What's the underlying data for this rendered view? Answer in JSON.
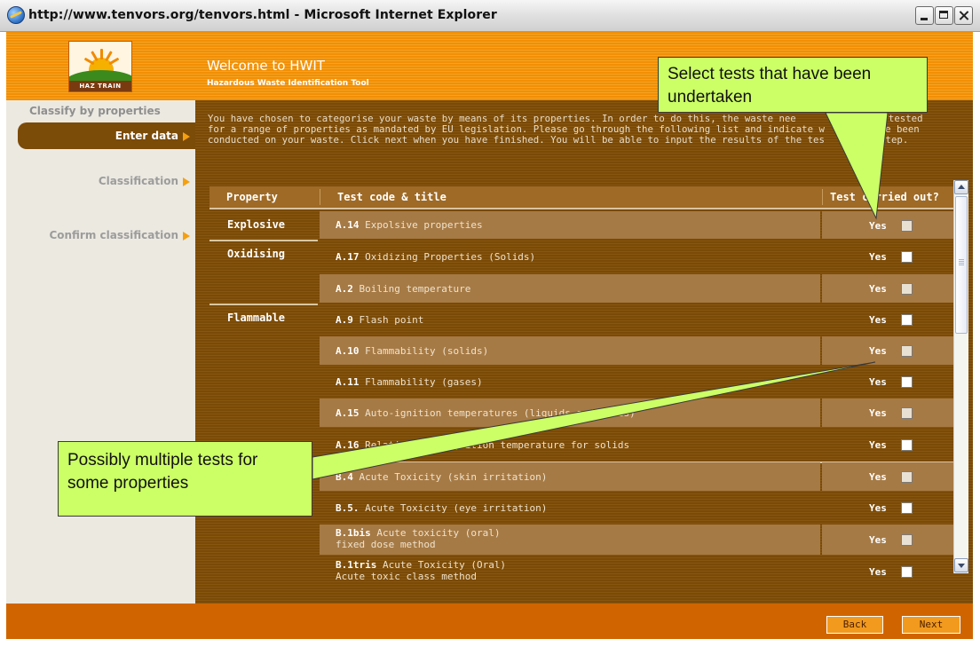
{
  "window": {
    "title": "http://www.tenvors.org/tenvors.html - Microsoft Internet Explorer"
  },
  "header": {
    "logo_text": "HAZ TRAIN",
    "title": "Welcome to HWIT",
    "subtitle": "Hazardous Waste Identification Tool"
  },
  "sidebar": {
    "category": "Classify by properties",
    "items": [
      {
        "label": "Enter data",
        "active": true
      },
      {
        "label": "Classification",
        "active": false
      },
      {
        "label": "Confirm classification",
        "active": false
      }
    ]
  },
  "intro": {
    "text_visible": "You have chosen to categorise your waste by means of its properties. In order to do this, the waste nee",
    "text_mid": "been tested",
    "line2_a": "for a range of properties as mandated by EU legislation. Please go through the following list and indicate w",
    "line2_b": "s have been",
    "line3_a": "conducted on your waste. Click next when you have finished. You will be able to input the results of the tes",
    "line3_b": "next step."
  },
  "table": {
    "headers": {
      "property": "Property",
      "test": "Test code & title",
      "carried_out": "Test carried out?"
    },
    "yes_label": "Yes",
    "rows": [
      {
        "property": "Explosive",
        "code": "A.14",
        "title": "Expolsive properties",
        "line2": "",
        "shade": "light"
      },
      {
        "property": "Oxidising",
        "code": "A.17",
        "title": "Oxidizing Properties (Solids)",
        "line2": "",
        "shade": "dark"
      },
      {
        "property": "",
        "code": "A.2",
        "title": "Boiling temperature",
        "line2": "",
        "shade": "light"
      },
      {
        "property": "Flammable",
        "code": "A.9",
        "title": "Flash point",
        "line2": "",
        "shade": "dark"
      },
      {
        "property": "",
        "code": "A.10",
        "title": "Flammability (solids)",
        "line2": "",
        "shade": "light"
      },
      {
        "property": "",
        "code": "A.11",
        "title": "Flammability (gases)",
        "line2": "",
        "shade": "dark"
      },
      {
        "property": "",
        "code": "A.15",
        "title": "Auto-ignition temperatures (liquids and gases)",
        "line2": "",
        "shade": "light"
      },
      {
        "property": "",
        "code": "A.16",
        "title": "Relative self-ignition temperature for solids",
        "line2": "",
        "shade": "dark"
      },
      {
        "property": "",
        "code": "B.4",
        "title": "Acute Toxicity (skin irritation)",
        "line2": "",
        "shade": "light"
      },
      {
        "property": "",
        "code": "B.5.",
        "title": "Acute Toxicity (eye irritation)",
        "line2": "",
        "shade": "dark"
      },
      {
        "property": "",
        "code": "B.1bis",
        "title": "Acute toxicity (oral)",
        "line2": "fixed dose method",
        "shade": "light"
      },
      {
        "property": "",
        "code": "B.1tris",
        "title": "Acute Toxicity (Oral)",
        "line2": "Acute toxic class method",
        "shade": "dark"
      }
    ]
  },
  "footer": {
    "back_label": "Back",
    "next_label": "Next"
  },
  "callouts": {
    "top": "Select tests that have been undertaken",
    "bottom": "Possibly multiple tests for some properties"
  },
  "colors": {
    "header_orange": "#f18f06",
    "content_brown": "#7a4a07",
    "row_light": "#a67a45",
    "footer_orange": "#d06500",
    "callout_green": "#ccff66"
  }
}
